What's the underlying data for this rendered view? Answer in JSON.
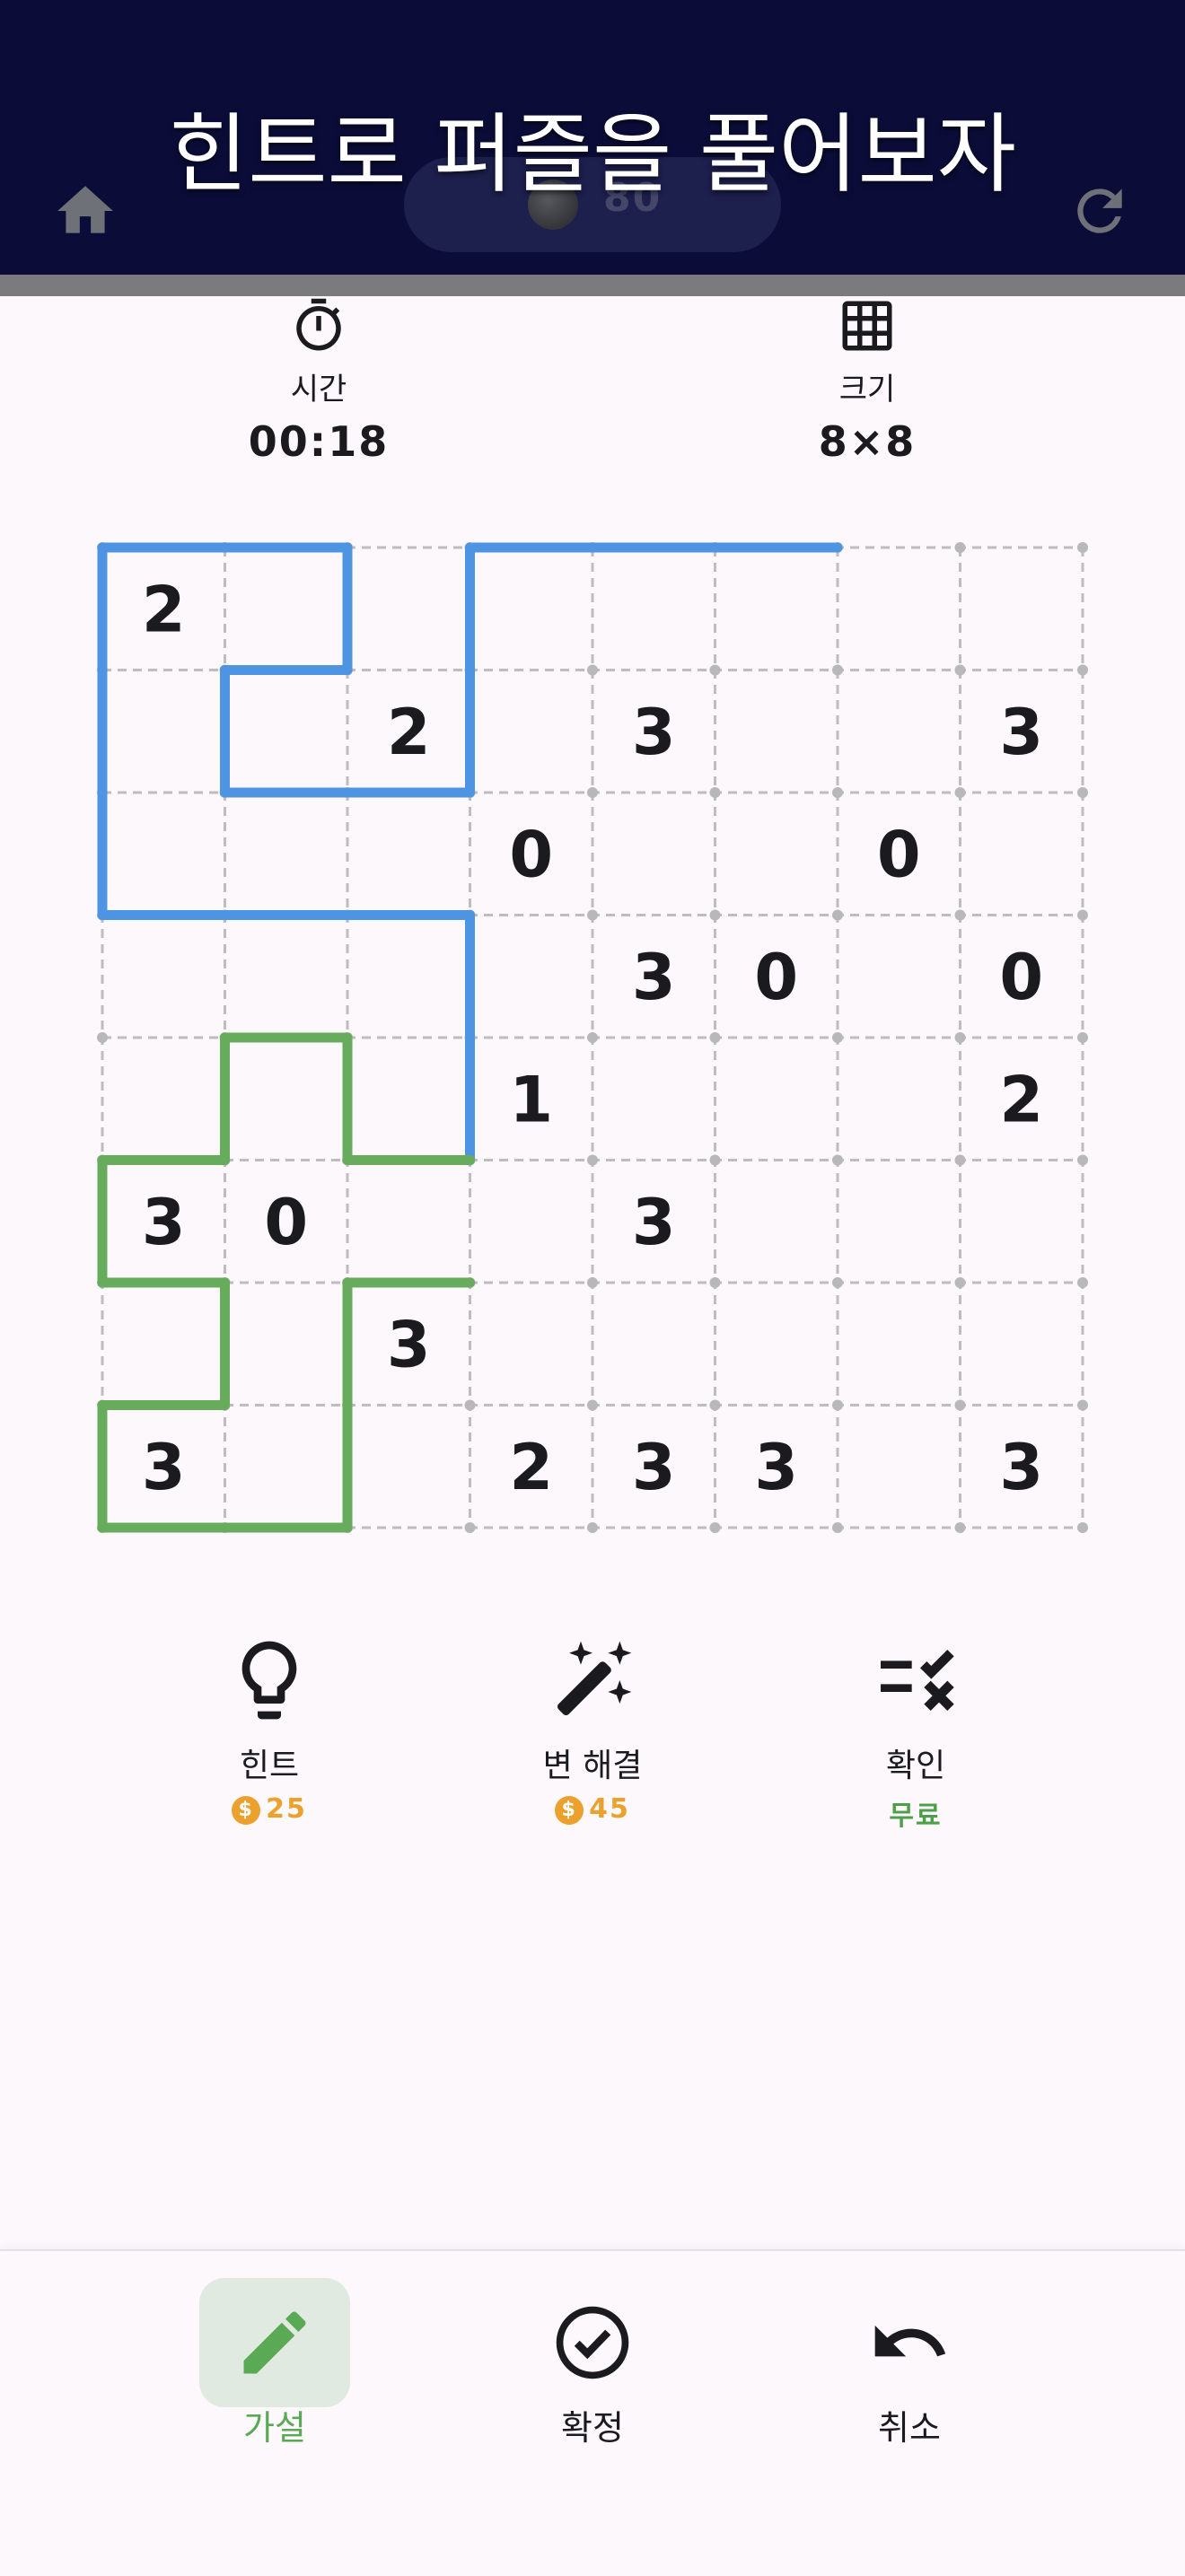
{
  "header": {
    "title": "힌트로 퍼즐을 풀어보자",
    "coins": "80",
    "bg_color": "#0b0d38"
  },
  "stats": {
    "time": {
      "icon": "stopwatch-icon",
      "label": "시간",
      "value": "00:18"
    },
    "size": {
      "icon": "grid-icon",
      "label": "크기",
      "value": "8×8"
    }
  },
  "board": {
    "rows": 8,
    "cols": 8,
    "clues": [
      [
        "2",
        "",
        "",
        "",
        "",
        "",
        "",
        ""
      ],
      [
        "",
        "",
        "2",
        "",
        "3",
        "",
        "",
        "3"
      ],
      [
        "",
        "",
        "",
        "0",
        "",
        "",
        "0",
        ""
      ],
      [
        "",
        "",
        "",
        "",
        "3",
        "0",
        "",
        "0"
      ],
      [
        "",
        "",
        "",
        "1",
        "",
        "",
        "",
        "2"
      ],
      [
        "3",
        "0",
        "",
        "",
        "3",
        "",
        "",
        ""
      ],
      [
        "",
        "",
        "3",
        "",
        "",
        "",
        "",
        ""
      ],
      [
        "3",
        "",
        "",
        "2",
        "3",
        "3",
        "",
        "3"
      ]
    ],
    "colors": {
      "blue": "#4d95e3",
      "green": "#67ab5c",
      "grid": "#bdbdbd"
    },
    "blue_segments": [
      [
        0,
        0,
        0,
        1
      ],
      [
        0,
        1,
        0,
        2
      ],
      [
        0,
        3,
        0,
        4
      ],
      [
        0,
        4,
        0,
        5
      ],
      [
        0,
        5,
        0,
        6
      ],
      [
        1,
        1,
        1,
        2
      ],
      [
        2,
        1,
        2,
        2
      ],
      [
        2,
        2,
        2,
        3
      ],
      [
        3,
        0,
        3,
        1
      ],
      [
        3,
        1,
        3,
        2
      ],
      [
        3,
        2,
        3,
        3
      ],
      [
        0,
        0,
        1,
        0
      ],
      [
        1,
        0,
        2,
        0
      ],
      [
        2,
        0,
        3,
        0
      ],
      [
        0,
        2,
        1,
        2
      ],
      [
        1,
        1,
        2,
        1
      ],
      [
        0,
        3,
        1,
        3
      ],
      [
        1,
        3,
        2,
        3
      ],
      [
        3,
        3,
        4,
        3
      ],
      [
        4,
        3,
        5,
        3
      ]
    ],
    "green_segments": [
      [
        4,
        1,
        4,
        2
      ],
      [
        5,
        0,
        5,
        1
      ],
      [
        5,
        2,
        5,
        3
      ],
      [
        6,
        0,
        6,
        1
      ],
      [
        6,
        2,
        6,
        3
      ],
      [
        7,
        0,
        7,
        1
      ],
      [
        8,
        0,
        8,
        1
      ],
      [
        8,
        1,
        8,
        2
      ],
      [
        4,
        1,
        5,
        1
      ],
      [
        4,
        2,
        5,
        2
      ],
      [
        5,
        0,
        6,
        0
      ],
      [
        6,
        1,
        7,
        1
      ],
      [
        7,
        0,
        8,
        0
      ],
      [
        6,
        2,
        7,
        2
      ],
      [
        7,
        2,
        8,
        2
      ]
    ]
  },
  "tools": [
    {
      "icon": "lightbulb-icon",
      "label": "힌트",
      "cost": "25",
      "coin_icon": "dollar-coin-icon"
    },
    {
      "icon": "magic-wand-icon",
      "label": "변 해결",
      "cost": "45",
      "coin_icon": "dollar-coin-icon"
    },
    {
      "icon": "check-list-icon",
      "label": "확인",
      "cost": "무료"
    }
  ],
  "bottom_nav": [
    {
      "icon": "pencil-icon",
      "label": "가설",
      "active": true
    },
    {
      "icon": "check-circle-icon",
      "label": "확정",
      "active": false
    },
    {
      "icon": "undo-icon",
      "label": "취소",
      "active": false
    }
  ]
}
